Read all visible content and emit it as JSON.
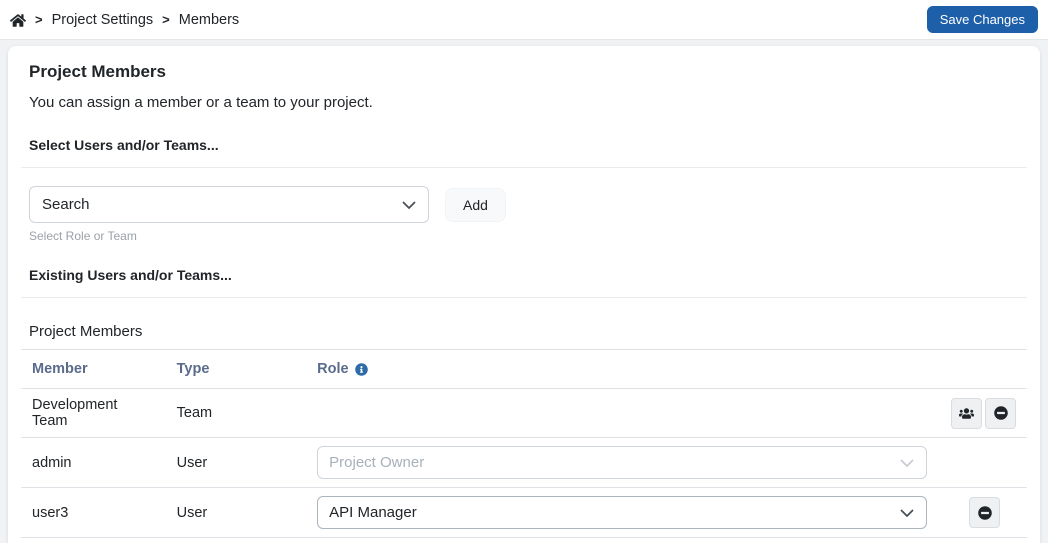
{
  "breadcrumb": {
    "separator": ">",
    "items": [
      "Project Settings",
      "Members"
    ]
  },
  "topbar": {
    "save_label": "Save Changes"
  },
  "page": {
    "title": "Project Members",
    "subtitle": "You can assign a member or a team to your project.",
    "select_section_label": "Select Users and/or Teams...",
    "existing_section_label": "Existing Users and/or Teams...",
    "table_caption": "Project Members"
  },
  "search": {
    "value": "Search",
    "helper": "Select Role or Team",
    "add_label": "Add"
  },
  "members_table": {
    "columns": [
      "Member",
      "Type",
      "Role"
    ],
    "rows": [
      {
        "member": "Development Team",
        "type": "Team",
        "role": ""
      },
      {
        "member": "admin",
        "type": "User",
        "role": "Project Owner",
        "role_disabled": "true"
      },
      {
        "member": "user3",
        "type": "User",
        "role": "API Manager"
      }
    ]
  },
  "colors": {
    "primary_button": "#1e5fa9",
    "table_header_text": "#5a6b8c",
    "info_icon": "#2d6ca8"
  }
}
